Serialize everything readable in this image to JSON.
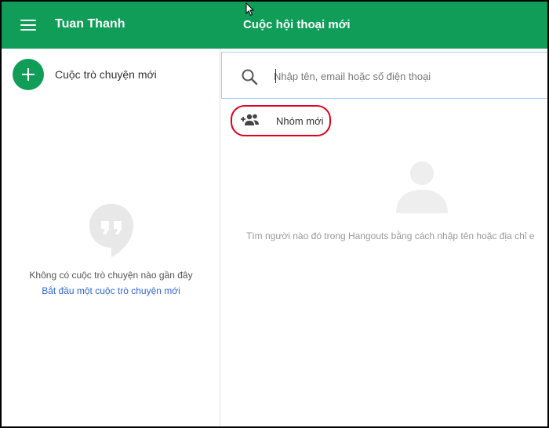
{
  "header": {
    "app_title": "Tuan Thanh",
    "conversation_title": "Cuộc hội thoại mới"
  },
  "sidebar": {
    "new_chat_label": "Cuộc trò chuyện mới",
    "empty_message": "Không có cuộc trò chuyện nào gần đây",
    "empty_link": "Bắt đầu một cuộc trò chuyện mới"
  },
  "main": {
    "search_placeholder": "Nhập tên, email hoặc số điện thoại",
    "search_value": "",
    "new_group_label": "Nhóm mới",
    "hint": "Tìm người nào đó trong Hangouts bằng cách nhập tên hoặc địa chỉ e"
  },
  "colors": {
    "brand": "#0f9d58",
    "highlight": "#e0001b",
    "link": "#3367d6"
  },
  "icons": [
    "menu-icon",
    "add-icon",
    "hangouts-logo-icon",
    "search-icon",
    "add-group-icon",
    "person-icon",
    "mouse-cursor-icon"
  ]
}
